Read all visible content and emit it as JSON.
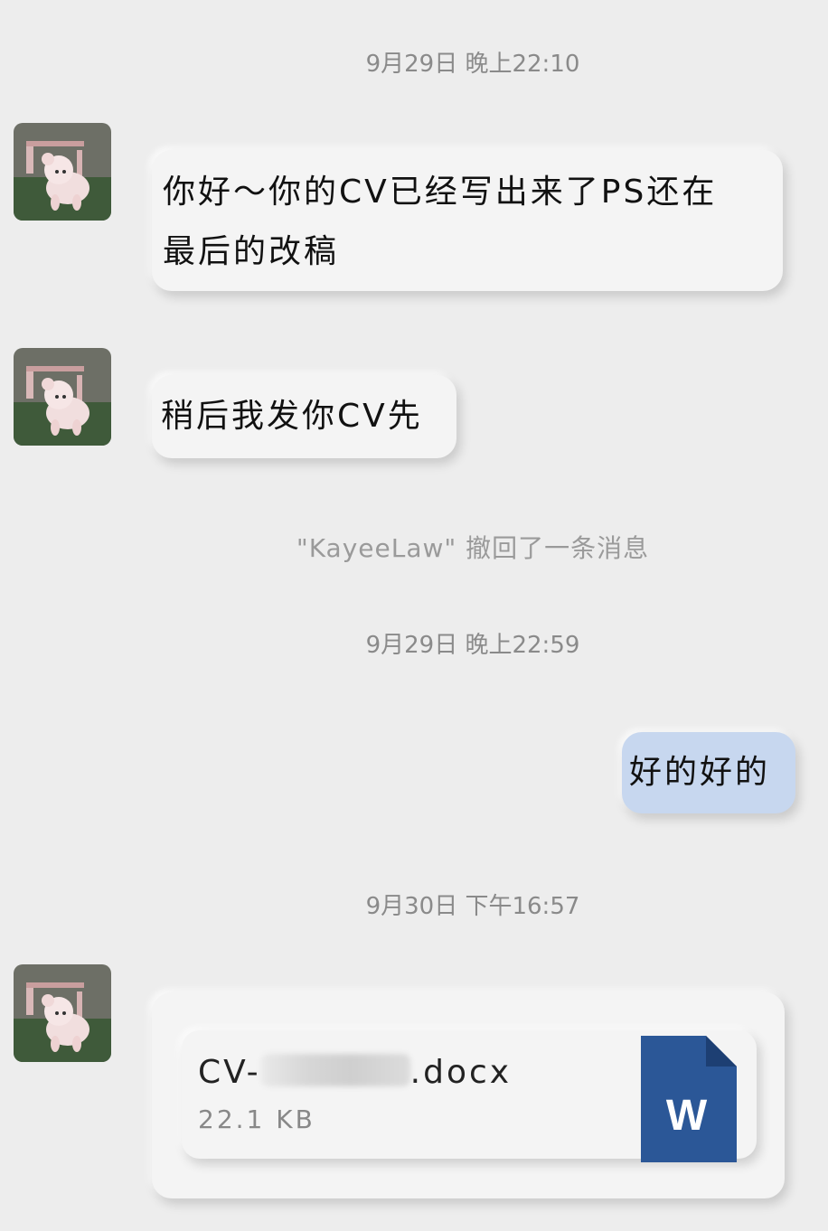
{
  "chat": {
    "timestamps": [
      "9月29日 晚上22:10",
      "9月29日 晚上22:59",
      "9月30日 下午16:57"
    ],
    "messages": {
      "m1_line1": "你好～你的CV已经写出来了PS还在",
      "m1_line2": "最后的改稿",
      "m2": "稍后我发你CV先",
      "recall_notice": "\"KayeeLaw\" 撤回了一条消息",
      "m3": "好的好的"
    },
    "file": {
      "name_prefix": "CV-",
      "name_suffix": ".docx",
      "size": "22.1 KB",
      "icon_letter": "W"
    }
  },
  "colors": {
    "background": "#ededed",
    "bubble_in": "#f4f4f4",
    "bubble_out": "#c7d7ef",
    "word_blue": "#2b5797"
  },
  "icons": {
    "avatar": "dog-avatar",
    "file": "word-document-icon"
  }
}
